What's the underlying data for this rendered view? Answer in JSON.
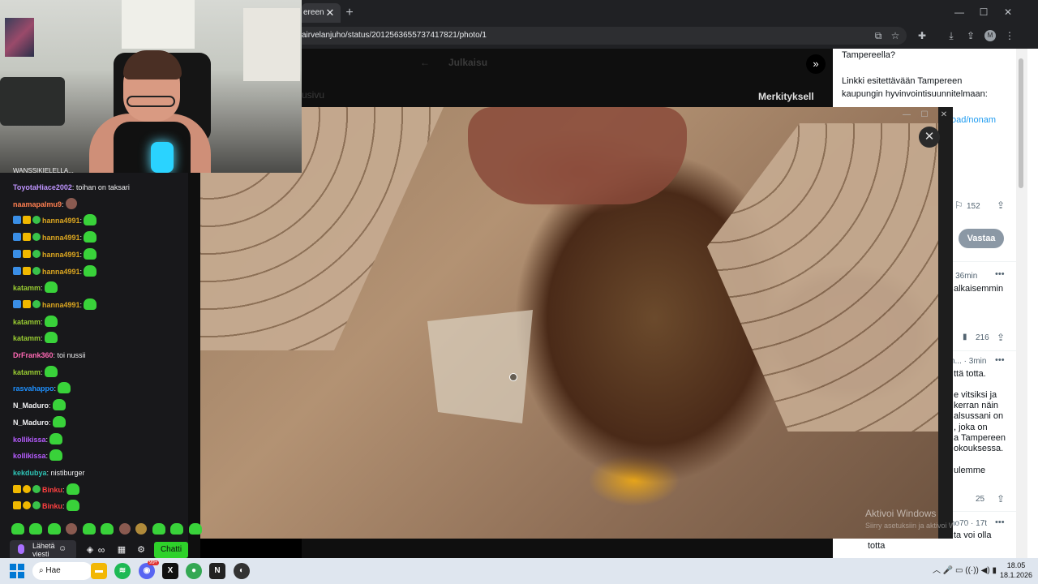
{
  "browser": {
    "tab_title": "ereen",
    "tab_close": "✕",
    "new_tab": "+",
    "url": "airvelanjuho/status/2012563655737417821/photo/1",
    "profile_initial": "M"
  },
  "x_page_behind": {
    "back_arrow": "←",
    "title": "Julkaisu",
    "left_label": "usivu",
    "right_heading": "Merkityksell"
  },
  "x_sidebar": {
    "line1": "Tampereella?",
    "line2": "Linkki esitettävään Tampereen",
    "line3": "kaupungin hyvinvointisuunnitelmaan:",
    "link": "oad/nonam",
    "bookmark_count": "152",
    "reply_button": "Vastaa",
    "reply1_meta": "· 36min",
    "reply1_text": "alkaisemmin",
    "reply1_views": "216",
    "reply2_meta": "n... · 3min",
    "reply2_text": "ttä totta.",
    "reply2_body": [
      "e vitsiksi ja",
      "kerran näin",
      "alsussani on",
      ", joka on",
      "a Tampereen",
      "okouksessa."
    ],
    "reply2_extra": "ulemme",
    "reply2_count": "25",
    "reply3_meta": "ho70 · 17t",
    "reply3_text": "ta voi olla",
    "reply3_last": "totta"
  },
  "popup": {
    "close": "✕",
    "watermark_title": "Aktivoi Windows",
    "watermark_sub": "Siirry asetuksiin ja aktivoi Windows."
  },
  "chat": {
    "top_partial": "WANSSIKIELELLA...",
    "messages": [
      {
        "user": "ToyotaHiace2002",
        "color": "#bf94ff",
        "text": ": toihan on taksari",
        "badges": [],
        "emote": ""
      },
      {
        "user": "naamapalmu9",
        "color": "#ff7f50",
        "text": ":",
        "badges": [],
        "emote": "face"
      },
      {
        "user": "hanna4991",
        "color": "#daa520",
        "text": ":",
        "badges": [
          "prime",
          "crown",
          "gift"
        ],
        "emote": "green"
      },
      {
        "user": "hanna4991",
        "color": "#daa520",
        "text": ":",
        "badges": [
          "prime",
          "crown",
          "gift"
        ],
        "emote": "green"
      },
      {
        "user": "hanna4991",
        "color": "#daa520",
        "text": ":",
        "badges": [
          "prime",
          "crown",
          "gift"
        ],
        "emote": "green"
      },
      {
        "user": "hanna4991",
        "color": "#daa520",
        "text": ":",
        "badges": [
          "prime",
          "crown",
          "gift"
        ],
        "emote": "green"
      },
      {
        "user": "katamm",
        "color": "#9acd32",
        "text": ":",
        "badges": [],
        "emote": "green"
      },
      {
        "user": "hanna4991",
        "color": "#daa520",
        "text": ":",
        "badges": [
          "prime",
          "crown",
          "gift"
        ],
        "emote": "green"
      },
      {
        "user": "katamm",
        "color": "#9acd32",
        "text": ":",
        "badges": [],
        "emote": "green"
      },
      {
        "user": "katamm",
        "color": "#9acd32",
        "text": ":",
        "badges": [],
        "emote": "green"
      },
      {
        "user": "DrFrank360",
        "color": "#ff69b4",
        "text": ": toi nussii",
        "badges": [],
        "emote": ""
      },
      {
        "user": "katamm",
        "color": "#9acd32",
        "text": ":",
        "badges": [],
        "emote": "green"
      },
      {
        "user": "rasvahappo",
        "color": "#1e90ff",
        "text": ":",
        "badges": [],
        "emote": "green"
      },
      {
        "user": "N_Maduro",
        "color": "#efeff1",
        "text": ":",
        "badges": [],
        "emote": "green"
      },
      {
        "user": "N_Maduro",
        "color": "#efeff1",
        "text": ":",
        "badges": [],
        "emote": "green"
      },
      {
        "user": "kollikissa",
        "color": "#b65cff",
        "text": ":",
        "badges": [],
        "emote": "green"
      },
      {
        "user": "kollikissa",
        "color": "#b65cff",
        "text": ":",
        "badges": [],
        "emote": "green"
      },
      {
        "user": "kekdubya",
        "color": "#2ec4b6",
        "text": ": nistiburger",
        "badges": [],
        "emote": ""
      },
      {
        "user": "Binku",
        "color": "#ff4040",
        "text": ":",
        "badges": [
          "crown",
          "one",
          "gift"
        ],
        "emote": "green"
      },
      {
        "user": "Binku",
        "color": "#ff4040",
        "text": ":",
        "badges": [
          "crown",
          "one",
          "gift"
        ],
        "emote": "green"
      }
    ],
    "send_label_line1": "Lähetä",
    "send_label_line2": "viesti",
    "chat_button": "Chatti"
  },
  "taskbar": {
    "search": "Hae",
    "discord_badge": "99+",
    "time": "18.05",
    "date": "18.1.2026"
  },
  "colors": {
    "twitch_green": "#2ed12a",
    "x_reply_button": "#8b98a5"
  }
}
